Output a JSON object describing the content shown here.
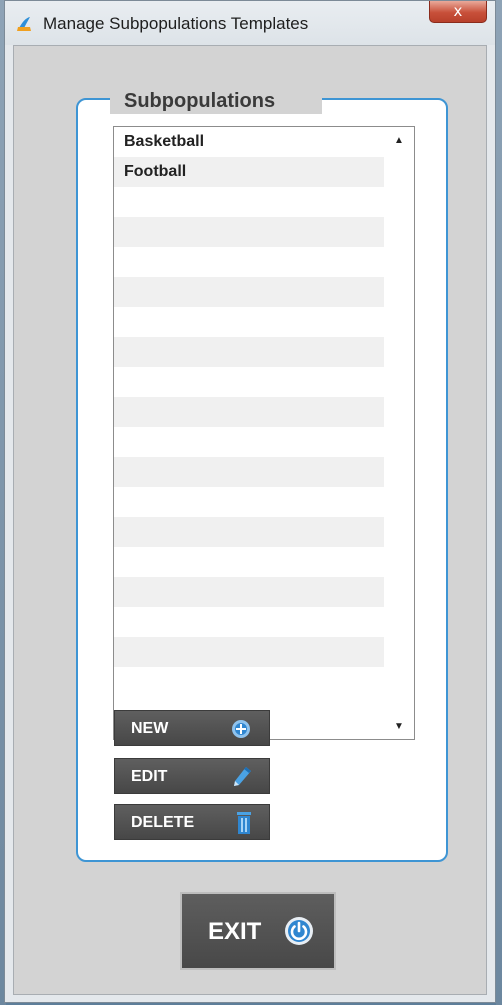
{
  "window": {
    "title": "Manage Subpopulations Templates",
    "close_symbol": "x"
  },
  "group": {
    "title": "Subpopulations"
  },
  "list": {
    "items": [
      "Basketball",
      "Football"
    ],
    "empty_rows": 16
  },
  "buttons": {
    "new_label": "NEW",
    "edit_label": "EDIT",
    "delete_label": "DELETE",
    "exit_label": "EXIT"
  },
  "icons": {
    "new": "plus-circle-icon",
    "edit": "pencil-icon",
    "delete": "trash-icon",
    "exit": "power-icon",
    "app": "app-logo-icon"
  },
  "colors": {
    "accent": "#3e95d4",
    "button_bg": "#4f4f4f",
    "client_bg": "#d3d3d3"
  }
}
